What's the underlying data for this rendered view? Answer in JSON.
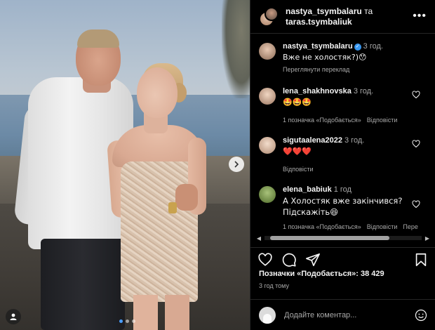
{
  "header": {
    "user1": "nastya_tsymbalaru",
    "conjunction": "та",
    "user2": "taras.tsymbaliuk",
    "more": "•••"
  },
  "comments": [
    {
      "user": "nastya_tsymbalaru",
      "verified": true,
      "time": "3 год.",
      "text": "Вже не холостяк?)😯",
      "see_translation": "Переглянути переклад",
      "avatar_color": "#c79a83"
    },
    {
      "user": "lena_shakhnovska",
      "time": "3 год.",
      "text": "🤩🤩🤩",
      "likes": "1 позначка «Подобається»",
      "reply": "Відповісти",
      "avatar_color": "#b58a70"
    },
    {
      "user": "sigutaalena2022",
      "time": "3 год.",
      "text": "❤️❤️❤️",
      "reply": "Відповісти",
      "avatar_color": "#d9a88e"
    },
    {
      "user": "elena_babiuk",
      "time": "1 год",
      "text": "А Холостяк вже закінчився? Підскажіть😆",
      "likes": "1 позначка «Подобається»",
      "reply": "Відповісти",
      "see_translation_cut": "Пере",
      "avatar_color": "#7a9a4e"
    }
  ],
  "likes_count": "Позначки «Подобається»: 38 429",
  "posted": "3 год тому",
  "add_comment": {
    "placeholder": "Додайте коментар..."
  },
  "carousel": {
    "total": 3,
    "active_index": 0
  },
  "colors": {
    "background": "#000000",
    "verified_blue": "#3897f0",
    "heart_red": "#ed4956",
    "carousel_active": "#4a9eff"
  }
}
